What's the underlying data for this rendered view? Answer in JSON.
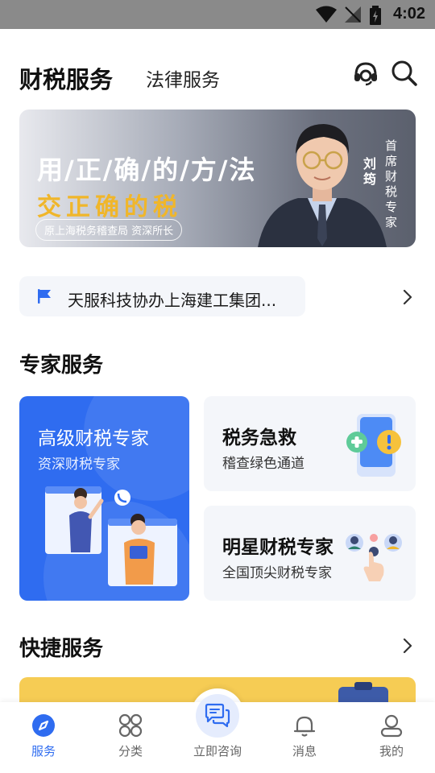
{
  "status_bar": {
    "time": "4:02"
  },
  "header": {
    "active_tab": "财税服务",
    "inactive_tab": "法律服务",
    "icons": [
      "headset-icon",
      "search-icon"
    ]
  },
  "banner": {
    "line1": "用/正/确/的/方/法",
    "line2": "交正确的税",
    "subtitle": "原上海税务稽查局 资深所长",
    "name": "刘筠",
    "title": "首席财税专家"
  },
  "notice": {
    "text": "天服科技协办上海建工集团...",
    "icon": "flag-icon"
  },
  "expert_section": {
    "title": "专家服务",
    "card_main": {
      "title": "高级财税专家",
      "subtitle": "资深财税专家"
    },
    "card_rescue": {
      "title": "税务急救",
      "subtitle": "稽查绿色通道"
    },
    "card_star": {
      "title": "明星财税专家",
      "subtitle": "全国顶尖财税专家"
    }
  },
  "quick_section": {
    "title": "快捷服务"
  },
  "bottom_nav": {
    "items": [
      {
        "label": "服务",
        "icon": "compass-icon",
        "active": true
      },
      {
        "label": "分类",
        "icon": "grid-icon",
        "active": false
      },
      {
        "label": "立即咨询",
        "icon": "chat-icon",
        "active": false
      },
      {
        "label": "消息",
        "icon": "bell-icon",
        "active": false
      },
      {
        "label": "我的",
        "icon": "user-icon",
        "active": false
      }
    ]
  },
  "colors": {
    "accent": "#2f6cf0",
    "banner_gold": "#f0b62a",
    "card_gray": "#f4f6fa",
    "strip_yellow": "#f6cc54"
  }
}
